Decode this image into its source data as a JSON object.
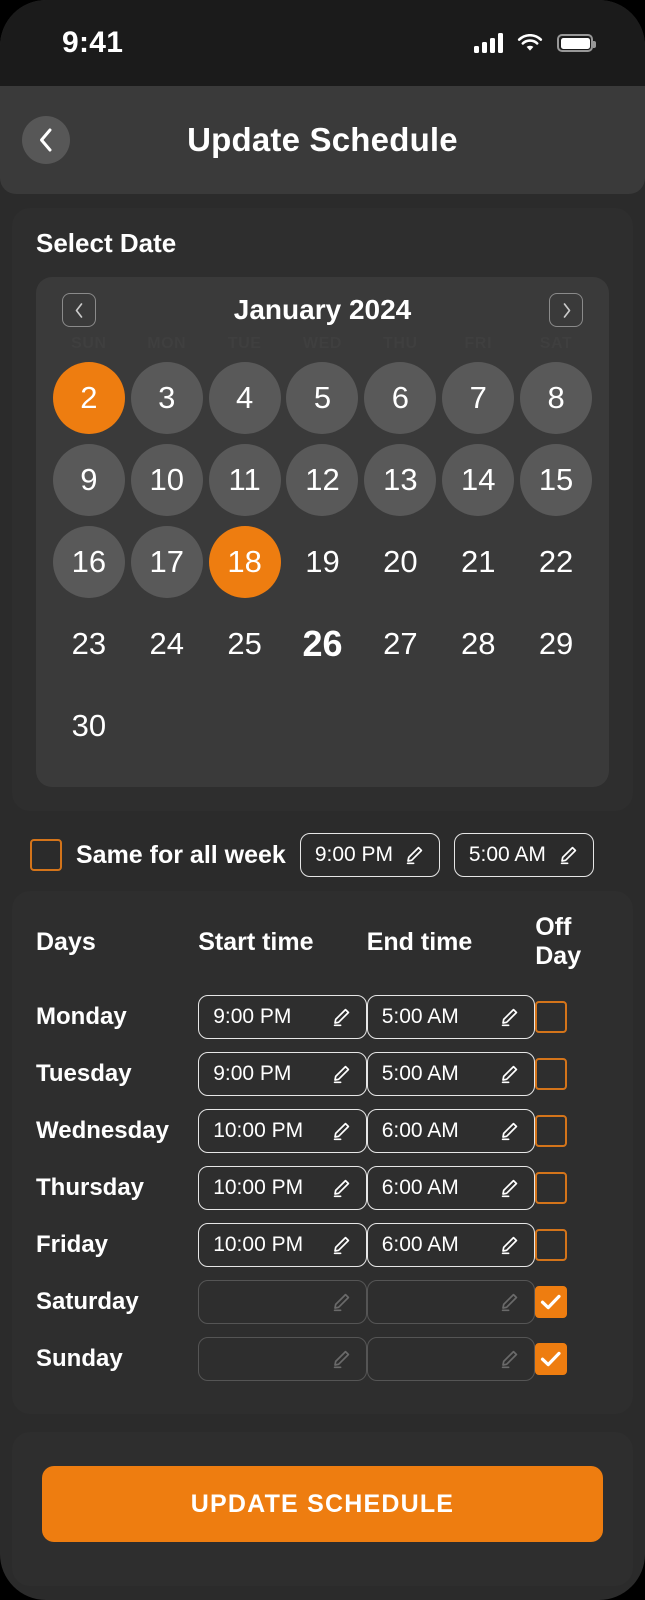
{
  "status_bar": {
    "time": "9:41",
    "signal_icon": "cellular-bars-icon",
    "wifi_icon": "wifi-icon",
    "battery_icon": "battery-full-icon"
  },
  "header": {
    "back_icon": "chevron-left-icon",
    "title": "Update Schedule"
  },
  "select_date": {
    "title": "Select Date",
    "prev_icon": "chevron-left-icon",
    "next_icon": "chevron-right-icon",
    "month_label": "January 2024",
    "weekdays": [
      "SUN",
      "MON",
      "TUE",
      "WED",
      "THU",
      "FRI",
      "SAT"
    ],
    "days": [
      {
        "n": "2",
        "style": "selected"
      },
      {
        "n": "3",
        "style": "circle"
      },
      {
        "n": "4",
        "style": "circle"
      },
      {
        "n": "5",
        "style": "circle"
      },
      {
        "n": "6",
        "style": "circle"
      },
      {
        "n": "7",
        "style": "circle"
      },
      {
        "n": "8",
        "style": "circle"
      },
      {
        "n": "9",
        "style": "circle"
      },
      {
        "n": "10",
        "style": "circle"
      },
      {
        "n": "11",
        "style": "circle"
      },
      {
        "n": "12",
        "style": "circle"
      },
      {
        "n": "13",
        "style": "circle"
      },
      {
        "n": "14",
        "style": "circle"
      },
      {
        "n": "15",
        "style": "circle"
      },
      {
        "n": "16",
        "style": "circle"
      },
      {
        "n": "17",
        "style": "circle"
      },
      {
        "n": "18",
        "style": "selected"
      },
      {
        "n": "19",
        "style": "plain"
      },
      {
        "n": "20",
        "style": "plain"
      },
      {
        "n": "21",
        "style": "plain"
      },
      {
        "n": "22",
        "style": "plain"
      },
      {
        "n": "23",
        "style": "plain"
      },
      {
        "n": "24",
        "style": "plain"
      },
      {
        "n": "25",
        "style": "plain"
      },
      {
        "n": "26",
        "style": "emphasis"
      },
      {
        "n": "27",
        "style": "plain"
      },
      {
        "n": "28",
        "style": "plain"
      },
      {
        "n": "29",
        "style": "plain"
      },
      {
        "n": "30",
        "style": "plain"
      }
    ]
  },
  "same_all_week": {
    "label": "Same for all week",
    "checked": false,
    "start_time": "9:00 PM",
    "end_time": "5:00 AM",
    "edit_icon": "pencil-icon"
  },
  "schedule_table": {
    "headers": {
      "days": "Days",
      "start": "Start time",
      "end": "End time",
      "off": "Off Day"
    },
    "rows": [
      {
        "day": "Monday",
        "start": "9:00 PM",
        "end": "5:00 AM",
        "off": false,
        "disabled": false
      },
      {
        "day": "Tuesday",
        "start": "9:00 PM",
        "end": "5:00 AM",
        "off": false,
        "disabled": false
      },
      {
        "day": "Wednesday",
        "start": "10:00 PM",
        "end": "6:00 AM",
        "off": false,
        "disabled": false
      },
      {
        "day": "Thursday",
        "start": "10:00 PM",
        "end": "6:00 AM",
        "off": false,
        "disabled": false
      },
      {
        "day": "Friday",
        "start": "10:00 PM",
        "end": "6:00 AM",
        "off": false,
        "disabled": false
      },
      {
        "day": "Saturday",
        "start": "",
        "end": "",
        "off": true,
        "disabled": true
      },
      {
        "day": "Sunday",
        "start": "",
        "end": "",
        "off": true,
        "disabled": true
      }
    ]
  },
  "footer": {
    "submit_label": "UPDATE SCHEDULE"
  },
  "colors": {
    "accent": "#ee7d10",
    "page_bg": "#2b2b2b",
    "card_bg": "#2e2e2e",
    "calendar_bg": "#3a3a3a",
    "day_circle": "#595959",
    "header_bg": "#3a3a3a",
    "status_bg": "#1b1b1b",
    "text": "#ffffff"
  }
}
